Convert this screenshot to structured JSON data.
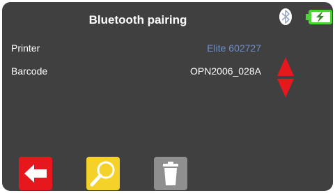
{
  "header": {
    "title": "Bluetooth pairing",
    "bluetooth_icon": "bluetooth-icon",
    "battery_icon": "battery-charging-icon",
    "battery_color": "#4cd137"
  },
  "rows": [
    {
      "label": "Printer",
      "value": "Elite 602727",
      "value_color": "#6f8fc8"
    },
    {
      "label": "Barcode",
      "value": "OPN2006_028A",
      "value_color": "#ffffff"
    }
  ],
  "scroll_icon": "up-down-arrows-icon",
  "buttons": [
    {
      "icon": "back-arrow-icon",
      "color": "#e6181d"
    },
    {
      "icon": "magnifier-icon",
      "color": "#f5d22a"
    },
    {
      "icon": "trash-icon",
      "color": "#8f8f8f"
    }
  ]
}
